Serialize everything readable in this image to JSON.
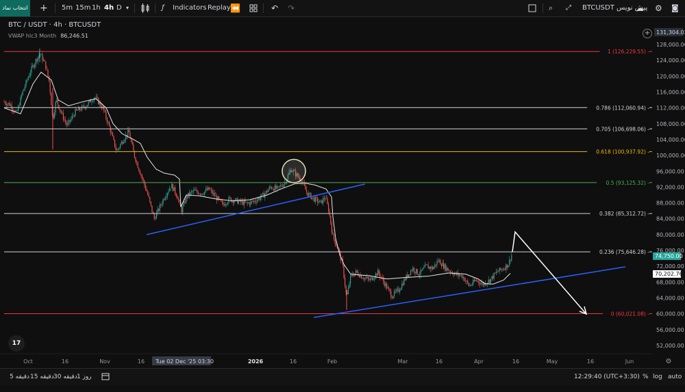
{
  "toolbar": {
    "symbol_pill": "انتخاب نماد",
    "add_label": "+",
    "intervals": [
      "5m",
      "15m",
      "1h",
      "4h",
      "D"
    ],
    "active_interval": "4h",
    "indicators_label": "Indicators",
    "replay_label": "Replay",
    "symbol_right": "BTCUSDT پیش نویس"
  },
  "legend": {
    "title": "BTC / USDT · 4h · BTCUSDT",
    "indicator_name": "VWAP hlc3 Month",
    "indicator_value": "86,246.51"
  },
  "price_axis": {
    "top_label": "131,304.02",
    "ticks": [
      "128,000.00",
      "124,000.00",
      "120,000.00",
      "116,000.00",
      "112,000.00",
      "108,000.00",
      "104,000.00",
      "100,000.00",
      "96,000.00",
      "92,000.00",
      "88,000.00",
      "84,000.00",
      "80,000.00",
      "76,000.00",
      "72,000.00",
      "68,000.00",
      "64,000.00",
      "60,000.00",
      "56,000.00",
      "52,000.00"
    ],
    "current_price": "74,750.00",
    "vwap_price": "70,202.76"
  },
  "fib_levels": [
    {
      "label": "1 (126,229.55)",
      "color": "#f23645"
    },
    {
      "label": "0.786 (112,060.94)",
      "color": "#d1d4dc"
    },
    {
      "label": "0.705 (106,698.06)",
      "color": "#d1d4dc"
    },
    {
      "label": "0.618 (100,937.92)",
      "color": "#f0b90b"
    },
    {
      "label": "0.5 (93,125.32)",
      "color": "#4caf50"
    },
    {
      "label": "0.382 (85,312.72)",
      "color": "#d1d4dc"
    },
    {
      "label": "0.236 (75,646.28)",
      "color": "#d1d4dc"
    },
    {
      "label": "0 (60,021.08)",
      "color": "#f23645"
    }
  ],
  "time_axis": {
    "ticks": [
      "Oct",
      "16",
      "Nov",
      "16",
      "16",
      "2026",
      "16",
      "Feb",
      "Mar",
      "16",
      "Apr",
      "16",
      "May",
      "16",
      "Jun"
    ],
    "crosshair_label": "Tue 02 Dec '25   03:30"
  },
  "bottombar": {
    "ranges": [
      "5 دقیقه",
      "15 دقیقه",
      "30 دقیقه",
      "1 روز"
    ],
    "clock": "12:29:40 (UTC+3:30)",
    "percent": "%",
    "log": "log",
    "auto": "auto"
  },
  "logo_text": "17"
}
